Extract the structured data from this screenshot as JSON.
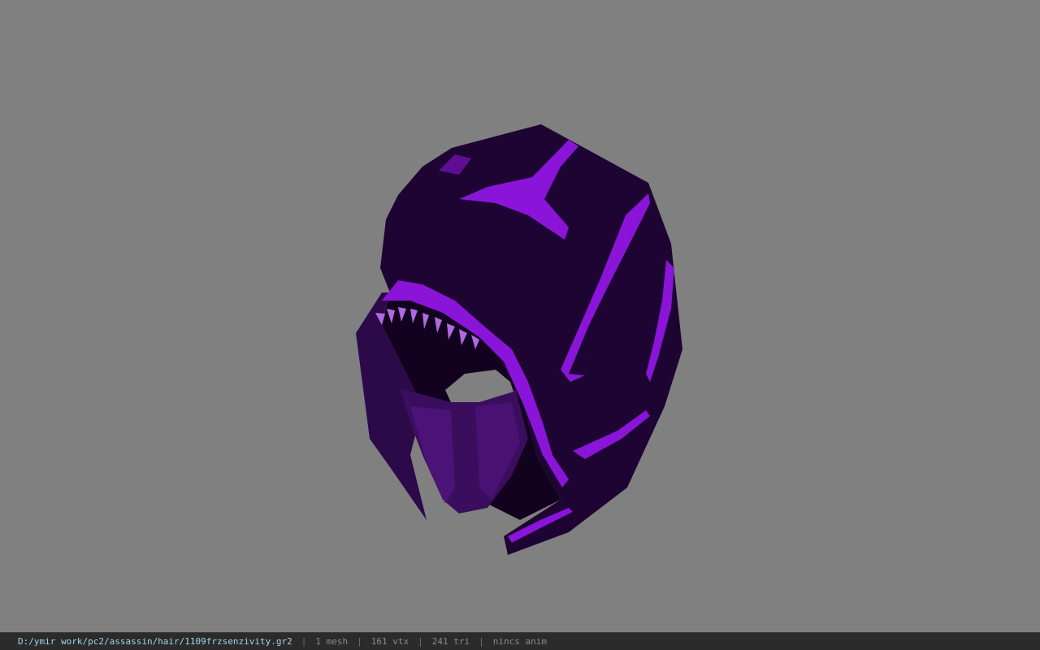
{
  "viewer": {
    "background_color": "#808080",
    "model": {
      "name": "hood-helmet-model",
      "base_color": "#1e0433",
      "shade_color": "#2c0a4a",
      "accent_color": "#8a14d8",
      "glow_color": "#a020f0"
    }
  },
  "statusbar": {
    "file_path": "D:/ymir work/pc2/assassin/hair/1109frzsenzivity.gr2",
    "separator": "|",
    "mesh_count": "1 mesh",
    "vertex_count": "161 vtx",
    "triangle_count": "241 tri",
    "anim_status": "nincs anim"
  }
}
